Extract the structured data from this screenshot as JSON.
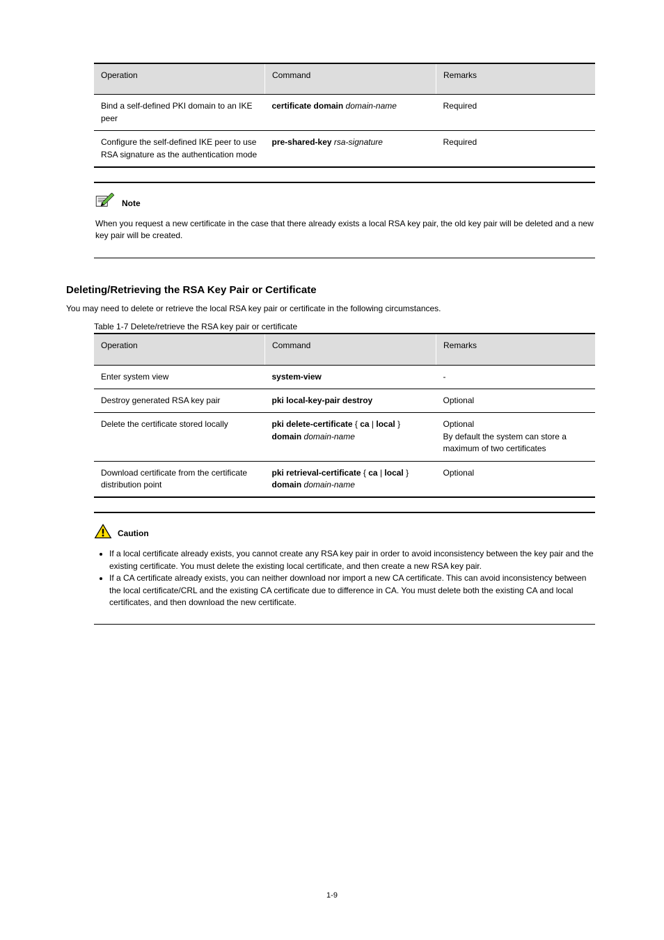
{
  "tables": {
    "t1": {
      "headers": [
        "Operation",
        "Command",
        "Remarks"
      ],
      "rows": [
        {
          "op": "Bind a self-defined PKI domain to an IKE peer",
          "cmd_html": "<span class='cmd-bold'>certificate domain</span> <span class='cmd-arg'>domain-name</span>",
          "rem": "Required"
        },
        {
          "op": "Configure the self-defined IKE peer to use RSA signature as the authentication mode",
          "cmd_html": "<span class='cmd-bold'>pre-shared-key</span> <span class='cmd-arg'>rsa-signature</span>",
          "rem": "Required"
        }
      ]
    },
    "t2": {
      "caption": "Table 1-7 Delete/retrieve the RSA key pair or certificate",
      "headers": [
        "Operation",
        "Command",
        "Remarks"
      ],
      "rows": [
        {
          "op": "Enter system view",
          "cmd_html": "<span class='cmd-bold'>system-view</span>",
          "rem": "-"
        },
        {
          "op": "Destroy generated RSA key pair",
          "cmd_html": "<span class='cmd-bold'>pki local-key-pair destroy</span>",
          "rem": "Optional"
        },
        {
          "op": "Delete the certificate stored locally",
          "cmd_html": "<span class='cmd-bold'>pki delete-certificate</span> { <span class='cmd-bold'>ca</span> | <span class='cmd-bold'>local</span> } <span class='cmd-bold'>domain</span> <span class='cmd-arg'>domain-name</span>",
          "rem": "Optional",
          "rem_extra": "By default the system can store a maximum of two certificates"
        },
        {
          "op": "Download certificate from the certificate distribution point",
          "cmd_html": "<span class='cmd-bold'>pki retrieval-certificate</span> { <span class='cmd-bold'>ca</span> | <span class='cmd-bold'>local</span> } <span class='cmd-bold'>domain</span> <span class='cmd-arg'>domain-name</span>",
          "rem": "Optional"
        }
      ]
    }
  },
  "note": {
    "label": "Note",
    "body": "When you request a new certificate in the case that there already exists a local RSA key pair, the old key pair will be deleted and a new key pair will be created."
  },
  "section_heading": "Deleting/Retrieving the RSA Key Pair or Certificate",
  "section_text": "You may need to delete or retrieve the local RSA key pair or certificate in the following circumstances.",
  "caution": {
    "label": "Caution",
    "items": [
      "If a local certificate already exists, you cannot create any RSA key pair in order to avoid inconsistency between the key pair and the existing certificate. You must delete the existing local certificate, and then create a new RSA key pair.",
      "If a CA certificate already exists, you can neither download nor import a new CA certificate. This can avoid inconsistency between the local certificate/CRL and the existing CA certificate due to difference in CA. You must delete both the existing CA and local certificates, and then download the new certificate."
    ]
  },
  "page_number": "1-9"
}
